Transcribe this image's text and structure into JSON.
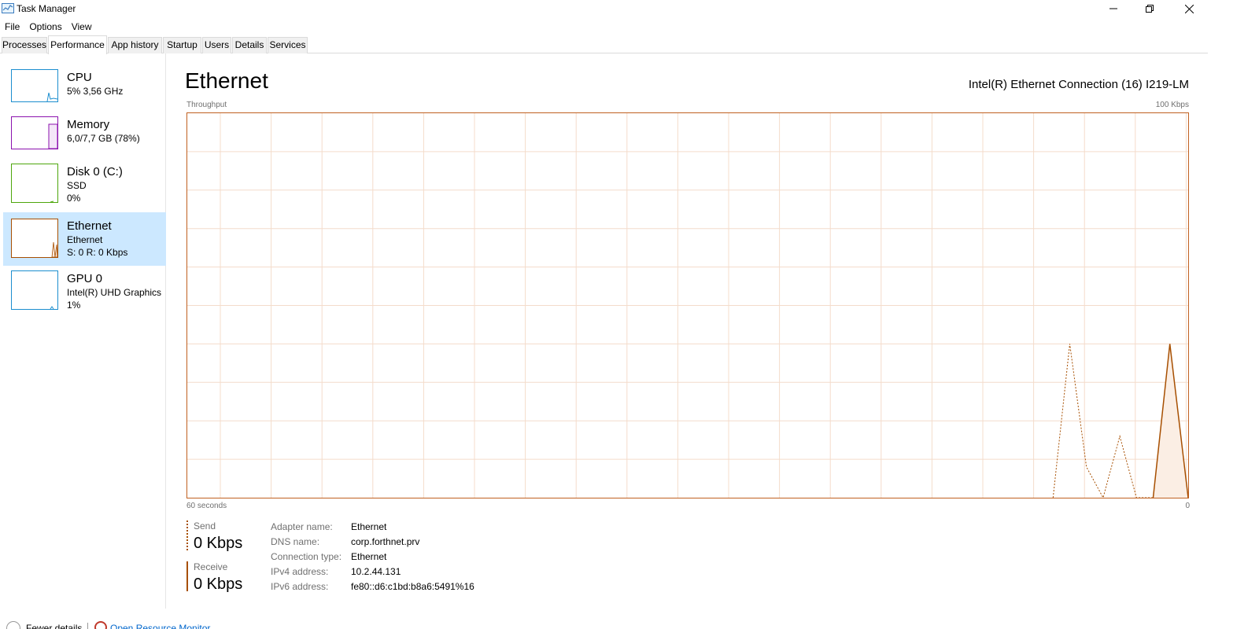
{
  "window": {
    "title": "Task Manager"
  },
  "menu": [
    "File",
    "Options",
    "View"
  ],
  "tabs": [
    "Processes",
    "Performance",
    "App history",
    "Startup",
    "Users",
    "Details",
    "Services"
  ],
  "active_tab": "Performance",
  "sidebar": [
    {
      "name": "CPU",
      "line1": "5% 3,56 GHz",
      "line2": "",
      "color": "#1c8ecf",
      "icon": "cpu-graph"
    },
    {
      "name": "Memory",
      "line1": "6,0/7,7 GB (78%)",
      "line2": "",
      "color": "#8b12ae",
      "icon": "memory-graph"
    },
    {
      "name": "Disk 0 (C:)",
      "line1": "SSD",
      "line2": "0%",
      "color": "#4da60c",
      "icon": "disk-graph"
    },
    {
      "name": "Ethernet",
      "line1": "Ethernet",
      "line2": "S: 0 R: 0 Kbps",
      "color": "#a74f01",
      "icon": "ethernet-graph"
    },
    {
      "name": "GPU 0",
      "line1": "Intel(R) UHD Graphics",
      "line2": "1%",
      "color": "#1c8ecf",
      "icon": "gpu-graph"
    }
  ],
  "main": {
    "title": "Ethernet",
    "adapter": "Intel(R) Ethernet Connection (16) I219-LM",
    "throughput_label": "Throughput",
    "max_label": "100 Kbps",
    "time_label": "60 seconds",
    "zero_label": "0"
  },
  "chart_data": {
    "type": "area",
    "x_range_seconds": [
      60,
      0
    ],
    "ylim_kbps": [
      0,
      100
    ],
    "grid": true,
    "series": [
      {
        "name": "Send",
        "style": "dotted",
        "x": [
          8.1,
          7.1,
          6.1,
          5.1,
          4.1,
          3.1,
          2.1,
          1.1,
          0
        ],
        "y": [
          0,
          40,
          8,
          0,
          16,
          0,
          0,
          31,
          0
        ]
      },
      {
        "name": "Receive",
        "style": "solid",
        "x": [
          2.1,
          1.1,
          0
        ],
        "y": [
          0,
          40,
          0
        ]
      }
    ],
    "color": "#a74f01"
  },
  "stats": {
    "send_label": "Send",
    "send_value": "0 Kbps",
    "receive_label": "Receive",
    "receive_value": "0 Kbps"
  },
  "properties": [
    {
      "label": "Adapter name:",
      "value": "Ethernet"
    },
    {
      "label": "DNS name:",
      "value": "corp.forthnet.prv"
    },
    {
      "label": "Connection type:",
      "value": "Ethernet"
    },
    {
      "label": "IPv4 address:",
      "value": "10.2.44.131"
    },
    {
      "label": "IPv6 address:",
      "value": "fe80::d6:c1bd:b8a6:5491%16"
    }
  ],
  "footer": {
    "fewer_details": "Fewer details",
    "open_monitor": "Open Resource Monitor"
  }
}
